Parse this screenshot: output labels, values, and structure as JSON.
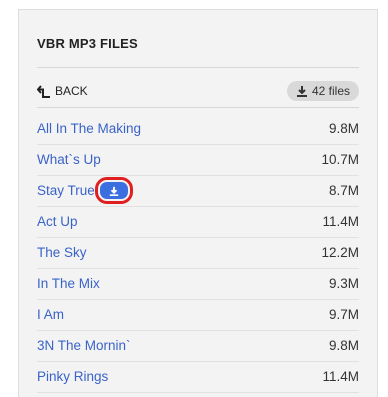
{
  "panel": {
    "title": "VBR MP3 FILES",
    "back_label": "BACK",
    "files_count_label": "42 files"
  },
  "files": [
    {
      "name": "All In The Making",
      "size": "9.8M"
    },
    {
      "name": "What`s Up",
      "size": "10.7M"
    },
    {
      "name": "Stay True",
      "size": "8.7M",
      "download_icon": true
    },
    {
      "name": "Act Up",
      "size": "11.4M"
    },
    {
      "name": "The Sky",
      "size": "12.2M"
    },
    {
      "name": "In The Mix",
      "size": "9.3M"
    },
    {
      "name": "I Am",
      "size": "9.7M"
    },
    {
      "name": "3N The Mornin`",
      "size": "9.8M"
    },
    {
      "name": "Pinky Rings",
      "size": "11.4M"
    }
  ],
  "icons": {
    "back": "arrow-up-left-icon",
    "files": "download-icon",
    "row_download": "download-icon"
  },
  "colors": {
    "link": "#3a63c8",
    "download_button": "#3b6fe0",
    "highlight_box": "#e02020"
  }
}
